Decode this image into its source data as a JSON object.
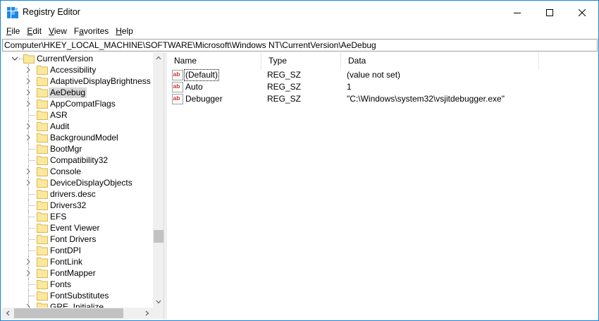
{
  "window": {
    "title": "Registry Editor",
    "icon": "registry-editor-icon"
  },
  "menu": [
    {
      "accel": "F",
      "rest": "ile"
    },
    {
      "accel": "E",
      "rest": "dit"
    },
    {
      "accel": "V",
      "rest": "iew"
    },
    {
      "accel": "F",
      "rest": "a",
      "accel_mid": true,
      "full": "Favorites"
    },
    {
      "accel": "H",
      "rest": "elp"
    }
  ],
  "address": {
    "value": "Computer\\HKEY_LOCAL_MACHINE\\SOFTWARE\\Microsoft\\Windows NT\\CurrentVersion\\AeDebug"
  },
  "tree": {
    "parent": "CurrentVersion",
    "items": [
      {
        "label": "Accessibility",
        "expandable": true
      },
      {
        "label": "AdaptiveDisplayBrightness",
        "expandable": true
      },
      {
        "label": "AeDebug",
        "expandable": true,
        "selected": true
      },
      {
        "label": "AppCompatFlags",
        "expandable": true
      },
      {
        "label": "ASR",
        "expandable": false
      },
      {
        "label": "Audit",
        "expandable": true
      },
      {
        "label": "BackgroundModel",
        "expandable": true
      },
      {
        "label": "BootMgr",
        "expandable": false
      },
      {
        "label": "Compatibility32",
        "expandable": false
      },
      {
        "label": "Console",
        "expandable": true
      },
      {
        "label": "DeviceDisplayObjects",
        "expandable": true
      },
      {
        "label": "drivers.desc",
        "expandable": false
      },
      {
        "label": "Drivers32",
        "expandable": false
      },
      {
        "label": "EFS",
        "expandable": false
      },
      {
        "label": "Event Viewer",
        "expandable": false
      },
      {
        "label": "Font Drivers",
        "expandable": false
      },
      {
        "label": "FontDPI",
        "expandable": false
      },
      {
        "label": "FontLink",
        "expandable": true
      },
      {
        "label": "FontMapper",
        "expandable": true
      },
      {
        "label": "Fonts",
        "expandable": false
      },
      {
        "label": "FontSubstitutes",
        "expandable": false
      },
      {
        "label": "GRE_Initialize",
        "expandable": true
      }
    ]
  },
  "list": {
    "columns": {
      "name": "Name",
      "type": "Type",
      "data": "Data"
    },
    "rows": [
      {
        "name": "(Default)",
        "type": "REG_SZ",
        "data": "(value not set)",
        "icon": "string-value-icon"
      },
      {
        "name": "Auto",
        "type": "REG_SZ",
        "data": "1",
        "icon": "string-value-icon"
      },
      {
        "name": "Debugger",
        "type": "REG_SZ",
        "data": "\"C:\\Windows\\system32\\vsjitdebugger.exe\"",
        "icon": "string-value-icon"
      }
    ]
  },
  "colors": {
    "window_border": "#1883d7",
    "folder_fill": "#fce89b",
    "selection": "#d9d9d9",
    "string_icon_red": "#d32f2f"
  }
}
